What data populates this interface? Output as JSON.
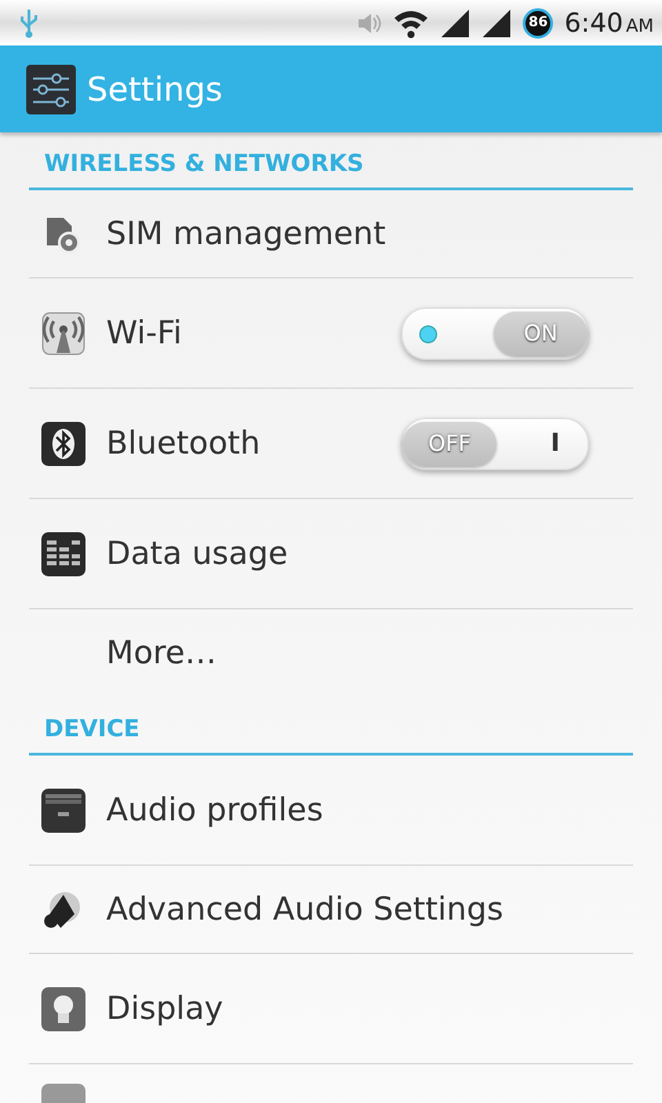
{
  "status_bar": {
    "battery": "86",
    "time": "6:40",
    "meridiem": "AM"
  },
  "action_bar": {
    "title": "Settings"
  },
  "sections": [
    {
      "header": "WIRELESS & NETWORKS",
      "items": [
        {
          "label": "SIM management",
          "kind": "plain"
        },
        {
          "label": "Wi-Fi",
          "kind": "toggle",
          "on": true,
          "thumb_label": "ON"
        },
        {
          "label": "Bluetooth",
          "kind": "toggle",
          "on": false,
          "thumb_label": "OFF",
          "track_label": "I"
        },
        {
          "label": "Data usage",
          "kind": "plain"
        },
        {
          "label": "More…",
          "kind": "plain"
        }
      ]
    },
    {
      "header": "DEVICE",
      "items": [
        {
          "label": "Audio profiles",
          "kind": "plain"
        },
        {
          "label": "Advanced Audio Settings",
          "kind": "plain"
        },
        {
          "label": "Display",
          "kind": "plain"
        }
      ]
    }
  ]
}
